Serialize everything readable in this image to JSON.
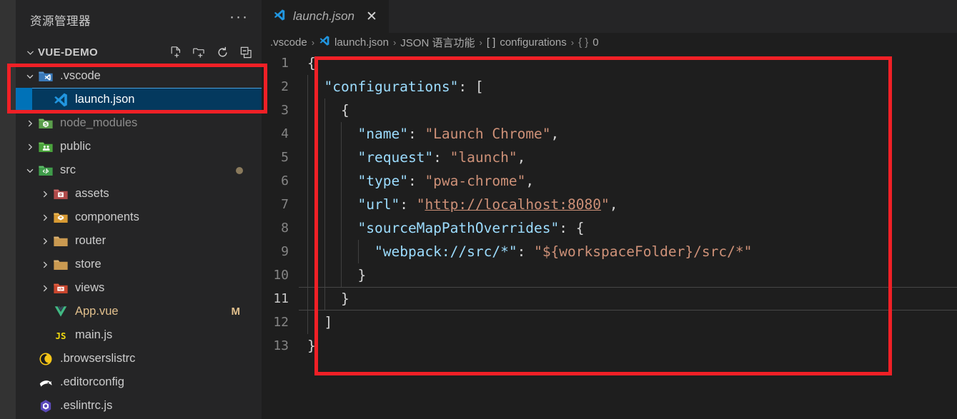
{
  "sidebar": {
    "title": "资源管理器",
    "more_actions": "···",
    "section": {
      "name": "VUE-DEMO",
      "actions": [
        {
          "name": "new-file",
          "tooltip": "新建文件"
        },
        {
          "name": "new-folder",
          "tooltip": "新建文件夹"
        },
        {
          "name": "refresh",
          "tooltip": "刷新资源管理器"
        },
        {
          "name": "collapse-all",
          "tooltip": "在资源管理器中折叠文件夹"
        }
      ]
    },
    "tree": [
      {
        "label": ".vscode",
        "icon": "vscode-folder-icon",
        "type": "folder",
        "expanded": true,
        "depth": 1,
        "state": "normal"
      },
      {
        "label": "launch.json",
        "icon": "vscode-file-icon",
        "type": "file",
        "depth": 2,
        "state": "selected"
      },
      {
        "label": "node_modules",
        "icon": "node-folder-icon",
        "type": "folder",
        "expanded": false,
        "depth": 1,
        "state": "dim"
      },
      {
        "label": "public",
        "icon": "public-folder-icon",
        "type": "folder",
        "expanded": false,
        "depth": 1,
        "state": "normal"
      },
      {
        "label": "src",
        "icon": "src-folder-icon",
        "type": "folder",
        "expanded": true,
        "depth": 1,
        "state": "normal",
        "dirty": true
      },
      {
        "label": "assets",
        "icon": "assets-folder-icon",
        "type": "folder",
        "expanded": false,
        "depth": 2,
        "state": "normal"
      },
      {
        "label": "components",
        "icon": "components-folder-icon",
        "type": "folder",
        "expanded": false,
        "depth": 2,
        "state": "normal"
      },
      {
        "label": "router",
        "icon": "plain-folder-icon",
        "type": "folder",
        "expanded": false,
        "depth": 2,
        "state": "normal"
      },
      {
        "label": "store",
        "icon": "plain-folder-icon",
        "type": "folder",
        "expanded": false,
        "depth": 2,
        "state": "normal"
      },
      {
        "label": "views",
        "icon": "views-folder-icon",
        "type": "folder",
        "expanded": false,
        "depth": 2,
        "state": "normal"
      },
      {
        "label": "App.vue",
        "icon": "vue-file-icon",
        "type": "file",
        "depth": 2,
        "state": "modified",
        "badge": "M"
      },
      {
        "label": "main.js",
        "icon": "js-file-icon",
        "type": "file",
        "depth": 2,
        "state": "normal"
      },
      {
        "label": ".browserslistrc",
        "icon": "browserslist-file-icon",
        "type": "file",
        "depth": 1,
        "state": "normal"
      },
      {
        "label": ".editorconfig",
        "icon": "editorconfig-file-icon",
        "type": "file",
        "depth": 1,
        "state": "normal"
      },
      {
        "label": ".eslintrc.js",
        "icon": "eslint-file-icon",
        "type": "file",
        "depth": 1,
        "state": "normal"
      }
    ]
  },
  "editor": {
    "tab": {
      "title": "launch.json",
      "icon": "vscode-file-icon",
      "close_label": "✕",
      "preview": true
    },
    "breadcrumb": [
      {
        "text": ".vscode",
        "icon": "none"
      },
      {
        "text": "launch.json",
        "icon": "vscode-file-icon"
      },
      {
        "text": "JSON 语言功能",
        "icon": "none"
      },
      {
        "text": "configurations",
        "icon": "array-symbol",
        "symbol": "[ ]"
      },
      {
        "text": "0",
        "icon": "object-symbol",
        "symbol": "{ }"
      }
    ],
    "breadcrumb_separator": "›",
    "current_line": 11,
    "lines": [
      {
        "n": "1",
        "indent": 0,
        "tokens": [
          {
            "t": "{",
            "c": "brace"
          }
        ]
      },
      {
        "n": "2",
        "indent": 1,
        "tokens": [
          {
            "t": "\"configurations\"",
            "c": "key"
          },
          {
            "t": ": ",
            "c": "punc"
          },
          {
            "t": "[",
            "c": "brace"
          }
        ]
      },
      {
        "n": "3",
        "indent": 2,
        "tokens": [
          {
            "t": "{",
            "c": "brace"
          }
        ]
      },
      {
        "n": "4",
        "indent": 3,
        "tokens": [
          {
            "t": "\"name\"",
            "c": "key"
          },
          {
            "t": ": ",
            "c": "punc"
          },
          {
            "t": "\"Launch Chrome\"",
            "c": "str"
          },
          {
            "t": ",",
            "c": "punc"
          }
        ]
      },
      {
        "n": "5",
        "indent": 3,
        "tokens": [
          {
            "t": "\"request\"",
            "c": "key"
          },
          {
            "t": ": ",
            "c": "punc"
          },
          {
            "t": "\"launch\"",
            "c": "str"
          },
          {
            "t": ",",
            "c": "punc"
          }
        ]
      },
      {
        "n": "6",
        "indent": 3,
        "tokens": [
          {
            "t": "\"type\"",
            "c": "key"
          },
          {
            "t": ": ",
            "c": "punc"
          },
          {
            "t": "\"pwa-chrome\"",
            "c": "str"
          },
          {
            "t": ",",
            "c": "punc"
          }
        ]
      },
      {
        "n": "7",
        "indent": 3,
        "tokens": [
          {
            "t": "\"url\"",
            "c": "key"
          },
          {
            "t": ": ",
            "c": "punc"
          },
          {
            "t": "\"",
            "c": "str"
          },
          {
            "t": "http://localhost:8080",
            "c": "link"
          },
          {
            "t": "\"",
            "c": "str"
          },
          {
            "t": ",",
            "c": "punc"
          }
        ]
      },
      {
        "n": "8",
        "indent": 3,
        "tokens": [
          {
            "t": "\"sourceMapPathOverrides\"",
            "c": "key"
          },
          {
            "t": ": ",
            "c": "punc"
          },
          {
            "t": "{",
            "c": "brace"
          }
        ]
      },
      {
        "n": "9",
        "indent": 4,
        "tokens": [
          {
            "t": "\"webpack://src/*\"",
            "c": "key"
          },
          {
            "t": ": ",
            "c": "punc"
          },
          {
            "t": "\"${workspaceFolder}/src/*\"",
            "c": "str"
          }
        ]
      },
      {
        "n": "10",
        "indent": 3,
        "tokens": [
          {
            "t": "}",
            "c": "brace"
          }
        ]
      },
      {
        "n": "11",
        "indent": 2,
        "tokens": [
          {
            "t": "}",
            "c": "brace"
          }
        ]
      },
      {
        "n": "12",
        "indent": 1,
        "tokens": [
          {
            "t": "]",
            "c": "brace"
          }
        ]
      },
      {
        "n": "13",
        "indent": 0,
        "tokens": [
          {
            "t": "}",
            "c": "brace"
          }
        ]
      }
    ]
  },
  "annotations": [
    {
      "name": "sidebar-highlight-box",
      "color": "#f12026"
    },
    {
      "name": "editor-highlight-box",
      "color": "#f12026"
    }
  ],
  "colors": {
    "sidebar_bg": "#252526",
    "editor_bg": "#1e1e1e",
    "activity_bar_bg": "#333333",
    "selection_bg": "#04395e",
    "selection_border": "#4a9eda",
    "accent_red": "#f12026",
    "token_key": "#9cdcfe",
    "token_string": "#ce9178",
    "modified_badge": "#e2c08d"
  }
}
